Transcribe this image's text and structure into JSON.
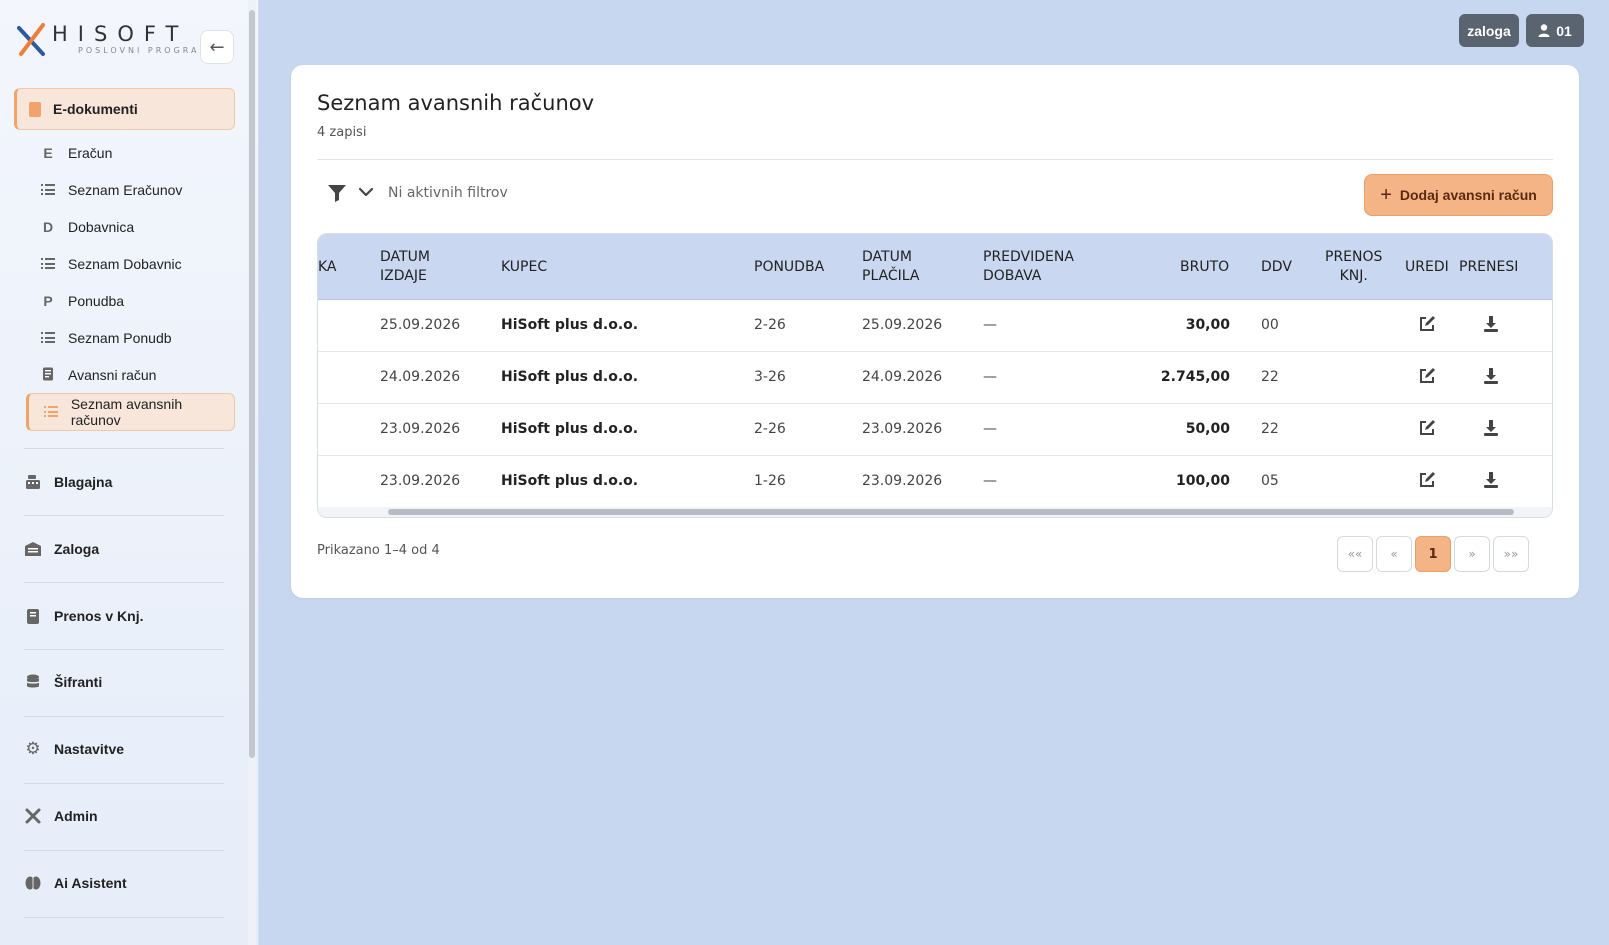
{
  "brand": {
    "name": "HISOFT",
    "tagline": "POSLOVNI PROGRAMI"
  },
  "sidebar": {
    "main_section": "E-dokumenti",
    "sub_items": [
      {
        "glyph": "E",
        "label": "Eračun"
      },
      {
        "glyph": "list",
        "label": "Seznam Eračunov"
      },
      {
        "glyph": "D",
        "label": "Dobavnica"
      },
      {
        "glyph": "list",
        "label": "Seznam Dobavnic"
      },
      {
        "glyph": "P",
        "label": "Ponudba"
      },
      {
        "glyph": "list",
        "label": "Seznam Ponudb"
      },
      {
        "glyph": "invoice",
        "label": "Avansni račun"
      },
      {
        "glyph": "list",
        "label": "Seznam avansnih računov",
        "active": true
      }
    ],
    "sections": [
      {
        "icon": "cash-register-icon",
        "label": "Blagajna"
      },
      {
        "icon": "warehouse-icon",
        "label": "Zaloga"
      },
      {
        "icon": "book-icon",
        "label": "Prenos v Knj."
      },
      {
        "icon": "database-icon",
        "label": "Šifranti"
      },
      {
        "icon": "gear-icon",
        "label": "Nastavitve"
      },
      {
        "icon": "tools-icon",
        "label": "Admin"
      },
      {
        "icon": "brain-icon",
        "label": "Ai Asistent"
      }
    ]
  },
  "topbar": {
    "stock_label": "zaloga",
    "user_label": "01"
  },
  "page": {
    "title": "Seznam avansnih računov",
    "count": "4 zapisi",
    "filter_text": "Ni aktivnih filtrov",
    "add_button": "Dodaj avansni račun"
  },
  "table": {
    "headers": {
      "stevilka": "KA",
      "datum_izdaje_1": "DATUM",
      "datum_izdaje_2": "IZDAJE",
      "kupec": "KUPEC",
      "ponudba": "PONUDBA",
      "datum_placila_1": "DATUM",
      "datum_placila_2": "PLAČILA",
      "dobava_1": "PREDVIDENA",
      "dobava_2": "DOBAVA",
      "bruto": "BRUTO",
      "ddv": "DDV",
      "prenos_1": "PRENOS",
      "prenos_2": "KNJ.",
      "uredi": "UREDI",
      "prenesi": "PRENESI"
    },
    "rows": [
      {
        "datum_izdaje": "25.09.2026",
        "kupec": "HiSoft plus d.o.o.",
        "ponudba": "2-26",
        "datum_placila": "25.09.2026",
        "dobava": "—",
        "bruto": "30,00",
        "ddv": "00"
      },
      {
        "datum_izdaje": "24.09.2026",
        "kupec": "HiSoft plus d.o.o.",
        "ponudba": "3-26",
        "datum_placila": "24.09.2026",
        "dobava": "—",
        "bruto": "2.745,00",
        "ddv": "22"
      },
      {
        "datum_izdaje": "23.09.2026",
        "kupec": "HiSoft plus d.o.o.",
        "ponudba": "2-26",
        "datum_placila": "23.09.2026",
        "dobava": "—",
        "bruto": "50,00",
        "ddv": "22"
      },
      {
        "datum_izdaje": "23.09.2026",
        "kupec": "HiSoft plus d.o.o.",
        "ponudba": "1-26",
        "datum_placila": "23.09.2026",
        "dobava": "—",
        "bruto": "100,00",
        "ddv": "05"
      }
    ]
  },
  "pagination": {
    "info": "Prikazano 1–4 od 4",
    "first": "««",
    "prev": "«",
    "current": "1",
    "next": "»",
    "last": "»»"
  },
  "colors": {
    "accent": "#f5b486",
    "header_bg": "#c9d8f0",
    "page_bg": "#c8d7f0"
  }
}
